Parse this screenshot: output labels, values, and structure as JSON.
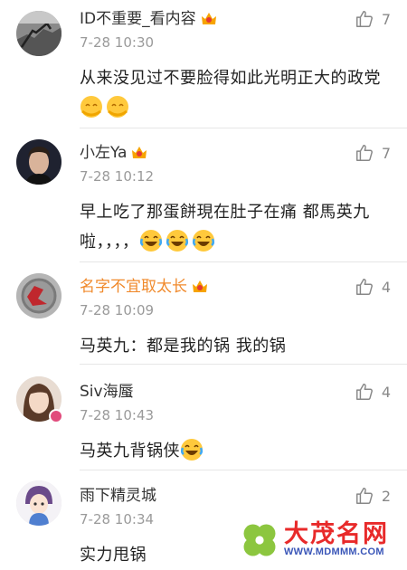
{
  "comments": [
    {
      "username": "ID不重要_看内容",
      "time": "7-28 10:30",
      "likes": "7",
      "text": "从来没见过不要脸得如此光明正大的政党",
      "emoji_after_text": [
        "bow-emoji",
        "bow-emoji"
      ]
    },
    {
      "username": "小左Ya",
      "time": "7-28 10:12",
      "likes": "7",
      "text": "早上吃了那蛋餅現在肚子在痛 都馬英九啦，，，，",
      "emoji_after_text": [
        "laugh-cry-emoji",
        "laugh-cry-emoji",
        "laugh-cry-emoji"
      ]
    },
    {
      "username": "名字不宜取太长",
      "time": "7-28 10:09",
      "likes": "4",
      "text": "马英九：都是我的锅 我的锅",
      "emoji_after_text": []
    },
    {
      "username": "Siv海蜃",
      "time": "7-28 10:43",
      "likes": "4",
      "text": "马英九背锅侠",
      "emoji_after_text": [
        "laugh-cry-emoji"
      ]
    },
    {
      "username": "雨下精灵城",
      "time": "7-28 10:34",
      "likes": "2",
      "text": "实力甩锅",
      "emoji_after_text": []
    }
  ],
  "watermark": {
    "title": "大茂名网",
    "url": "WWW.MDMMM.COM"
  },
  "colors": {
    "username": "#333333",
    "username_highlight": "#f08a2c",
    "time": "#9a9a9a",
    "like": "#888888",
    "watermark_red": "#e82a2a",
    "watermark_blue": "#3a56b8"
  }
}
